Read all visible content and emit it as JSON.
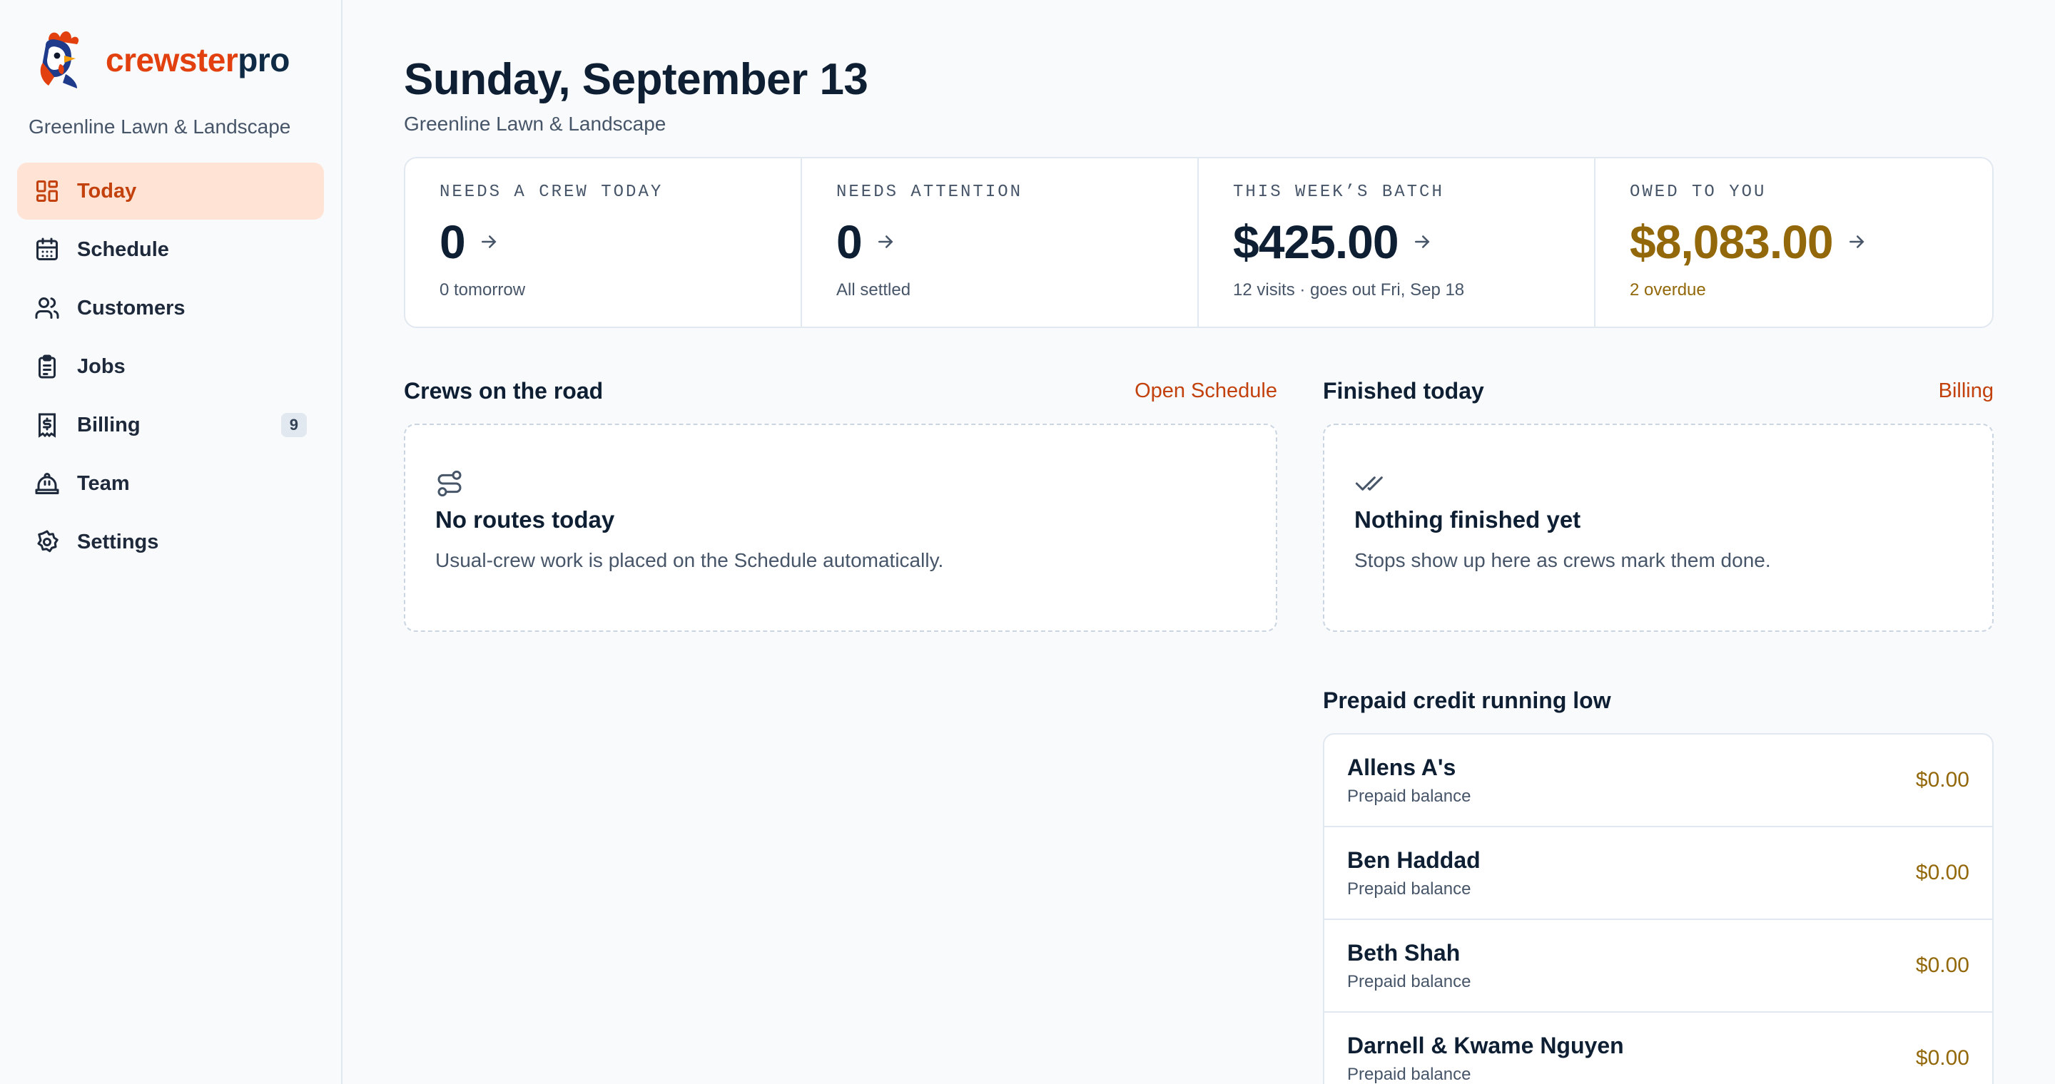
{
  "brand": {
    "part1": "crewster",
    "part2": "pro",
    "colors": {
      "primary": "#e2410f",
      "dark": "#0f2a44"
    }
  },
  "org_name": "Greenline Lawn & Landscape",
  "nav": [
    {
      "label": "Today",
      "icon": "dashboard-icon",
      "active": true
    },
    {
      "label": "Schedule",
      "icon": "calendar-icon"
    },
    {
      "label": "Customers",
      "icon": "users-icon"
    },
    {
      "label": "Jobs",
      "icon": "clipboard-icon"
    },
    {
      "label": "Billing",
      "icon": "receipt-dollar-icon",
      "badge": "9"
    },
    {
      "label": "Team",
      "icon": "hard-hat-icon"
    },
    {
      "label": "Settings",
      "icon": "gear-icon"
    }
  ],
  "header": {
    "title": "Sunday, September 13",
    "subtitle": "Greenline Lawn & Landscape"
  },
  "stats": [
    {
      "label": "NEEDS A CREW TODAY",
      "value": "0",
      "note": "0 tomorrow"
    },
    {
      "label": "NEEDS ATTENTION",
      "value": "0",
      "note": "All settled"
    },
    {
      "label": "THIS WEEK’S BATCH",
      "value": "$425.00",
      "note": "12 visits · goes out Fri, Sep 18"
    },
    {
      "label": "OWED TO YOU",
      "value": "$8,083.00",
      "note": "2 overdue",
      "tone": "#92680a"
    }
  ],
  "crews": {
    "title": "Crews on the road",
    "link": "Open Schedule",
    "empty_title": "No routes today",
    "empty_desc": "Usual-crew work is placed on the Schedule automatically.",
    "icon": "route-icon"
  },
  "finished": {
    "title": "Finished today",
    "link": "Billing",
    "empty_title": "Nothing finished yet",
    "empty_desc": "Stops show up here as crews mark them done.",
    "icon": "double-check-icon"
  },
  "prepaid": {
    "title": "Prepaid credit running low",
    "rows": [
      {
        "name": "Allens A's",
        "sub": "Prepaid balance",
        "amount": "$0.00"
      },
      {
        "name": "Ben Haddad",
        "sub": "Prepaid balance",
        "amount": "$0.00"
      },
      {
        "name": "Beth Shah",
        "sub": "Prepaid balance",
        "amount": "$0.00"
      },
      {
        "name": "Darnell & Kwame Nguyen",
        "sub": "Prepaid balance",
        "amount": "$0.00"
      }
    ]
  }
}
